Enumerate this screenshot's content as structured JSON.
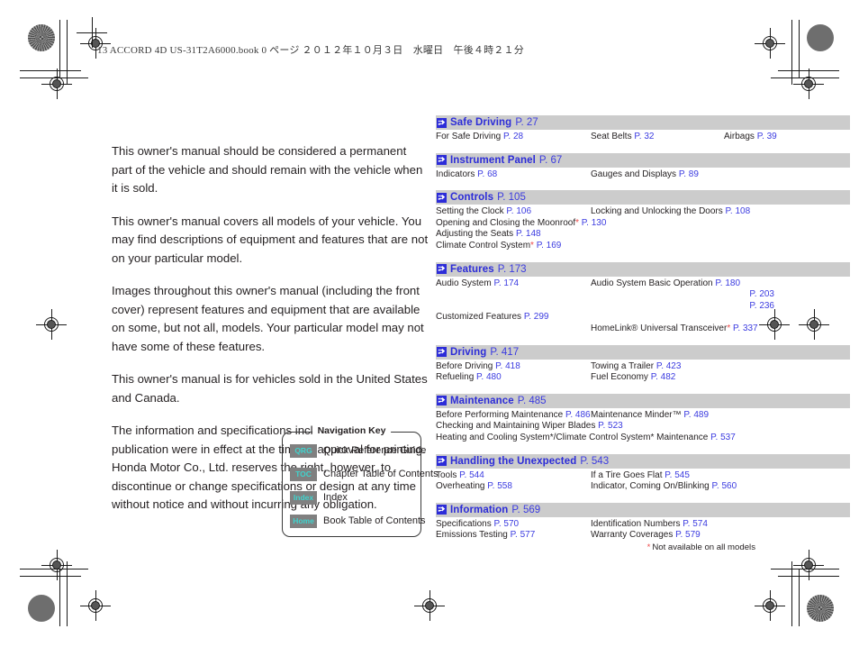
{
  "imprint": "13 ACCORD 4D US-31T2A6000.book  0 ページ  ２０１２年１０月３日　水曜日　午後４時２１分",
  "body_paragraphs": [
    "This owner's manual should be considered a permanent part of the vehicle and should remain with the vehicle when it is sold.",
    "This owner's manual covers all models of your vehicle. You may find descriptions of equipment and features that are not on your particular model.",
    "Images throughout this owner's manual (including the front cover) represent features and equipment that are available on some, but not all, models. Your particular model may not have some of these features.",
    "This owner's manual is for vehicles sold in the United States and Canada.",
    "The information and specifications included in this publication were in effect at the time of approval for printing. Honda Motor Co., Ltd. reserves the right, however, to discontinue or change specifications or design at any time without notice and without incurring any obligation."
  ],
  "navigation_key": {
    "title": "Navigation Key",
    "rows": [
      {
        "badge": "QRG",
        "label": "Quick Reference Guide"
      },
      {
        "badge": "TOC",
        "label": "Chapter Table of Contents"
      },
      {
        "badge": "Index",
        "label": "Index"
      },
      {
        "badge": "Home",
        "label": "Book Table of Contents"
      }
    ]
  },
  "footnote": {
    "asterisk": "*",
    "text": "Not available on all models"
  },
  "colors": {
    "header_bar": "#cccccc",
    "link_blue": "#3b3be0",
    "title_blue": "#2c2cd8",
    "asterisk_red": "#ee4b4b",
    "badge_bg": "#808080",
    "badge_text": "#3fd3cd"
  },
  "toc": [
    {
      "title": "Safe Driving",
      "page": "P. 27",
      "rows": [
        [
          {
            "label": "For Safe Driving",
            "page": "P. 28"
          },
          {
            "label": "Seat Belts",
            "page": "P. 32"
          },
          {
            "label": "Airbags",
            "page": "P. 39"
          }
        ]
      ]
    },
    {
      "title": "Instrument Panel",
      "page": "P. 67",
      "rows": [
        [
          {
            "label": "Indicators",
            "page": "P. 68"
          },
          {
            "label": "Gauges and Displays",
            "page": "P. 89"
          }
        ]
      ]
    },
    {
      "title": "Controls",
      "page": "P. 105",
      "rows": [
        [
          {
            "label": "Setting the Clock",
            "page": "P. 106"
          },
          {
            "label": "Locking and Unlocking the Doors",
            "page": "P. 108"
          }
        ],
        [
          {
            "label": "Opening and Closing the Moonroof",
            "asterisk": "*",
            "page": "P. 130"
          }
        ],
        [
          {
            "label": "Adjusting the Seats",
            "page": "P. 148"
          }
        ],
        [
          {
            "label": "Climate Control System",
            "asterisk": "*",
            "page": "P. 169"
          }
        ]
      ]
    },
    {
      "title": "Features",
      "page": "P. 173",
      "rows": [
        [
          {
            "label": "Audio System",
            "page": "P. 174"
          },
          {
            "label": "Audio System Basic Operation",
            "page": "P. 180",
            "extra_pages": [
              "P. 203",
              "P. 236"
            ]
          }
        ],
        [
          {
            "label": "Customized Features",
            "page": "P. 299"
          }
        ],
        [
          {
            "label": "",
            "page": ""
          },
          {
            "label": "HomeLink® Universal Transceiver",
            "asterisk": "*",
            "page": "P. 337"
          }
        ]
      ]
    },
    {
      "title": "Driving",
      "page": "P. 417",
      "rows": [
        [
          {
            "label": "Before Driving",
            "page": "P. 418"
          },
          {
            "label": "Towing a Trailer",
            "page": "P. 423"
          }
        ],
        [
          {
            "label": "Refueling",
            "page": "P. 480"
          },
          {
            "label": "Fuel Economy",
            "page": "P. 482"
          }
        ]
      ]
    },
    {
      "title": "Maintenance",
      "page": "P. 485",
      "rows": [
        [
          {
            "label": "Before Performing Maintenance",
            "page": "P. 486"
          },
          {
            "label": "Maintenance Minder™",
            "page": "P. 489"
          }
        ],
        [
          {
            "label": "Checking and Maintaining Wiper Blades",
            "page": "P. 523"
          }
        ],
        [
          {
            "label": "Heating and Cooling System*/Climate Control System* Maintenance",
            "page": "P. 537"
          }
        ]
      ]
    },
    {
      "title": "Handling the Unexpected",
      "page": "P. 543",
      "rows": [
        [
          {
            "label": "Tools",
            "page": "P. 544"
          },
          {
            "label": "If a Tire Goes Flat",
            "page": "P. 545"
          }
        ],
        [
          {
            "label": "Overheating",
            "page": "P. 558"
          },
          {
            "label": "Indicator, Coming On/Blinking",
            "page": "P. 560"
          }
        ]
      ]
    },
    {
      "title": "Information",
      "page": "P. 569",
      "rows": [
        [
          {
            "label": "Specifications",
            "page": "P. 570"
          },
          {
            "label": "Identification Numbers",
            "page": "P. 574"
          }
        ],
        [
          {
            "label": "Emissions Testing",
            "page": "P. 577"
          },
          {
            "label": "Warranty Coverages",
            "page": "P. 579"
          }
        ]
      ]
    }
  ]
}
